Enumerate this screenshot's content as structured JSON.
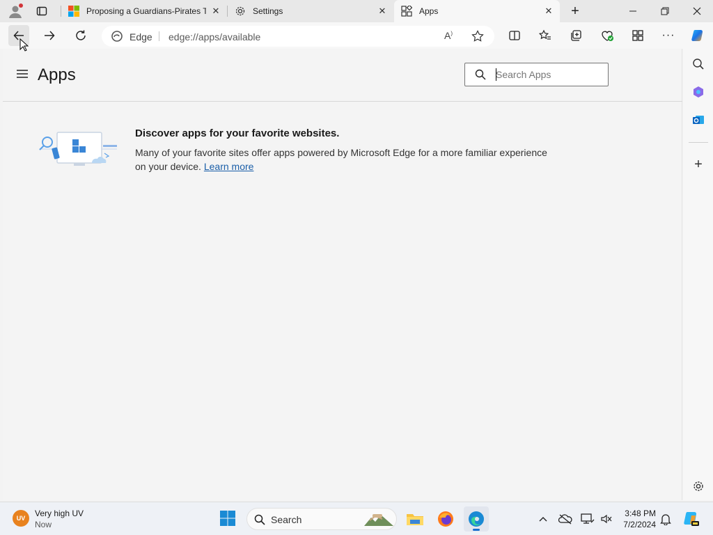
{
  "browser": {
    "tabs": [
      {
        "title": "Proposing a Guardians-Pirates Tr",
        "icon": "microsoft-logo-icon"
      },
      {
        "title": "Settings",
        "icon": "gear-icon"
      },
      {
        "title": "Apps",
        "icon": "apps-icon",
        "active": true
      }
    ],
    "address": {
      "site_label": "Edge",
      "url": "edge://apps/available"
    }
  },
  "page": {
    "title": "Apps",
    "search_placeholder": "Search Apps",
    "discover": {
      "title": "Discover apps for your favorite websites.",
      "description": "Many of your favorite sites offer apps powered by Microsoft Edge for a more familiar experience on your device.",
      "learn_more": "Learn more"
    }
  },
  "taskbar": {
    "weather": {
      "line1": "Very high UV",
      "line2": "Now",
      "badge": "UV"
    },
    "search_label": "Search",
    "time": "3:48 PM",
    "date": "7/2/2024"
  },
  "colors": {
    "accent": "#0f6cbd",
    "link": "#1a5ea8"
  }
}
